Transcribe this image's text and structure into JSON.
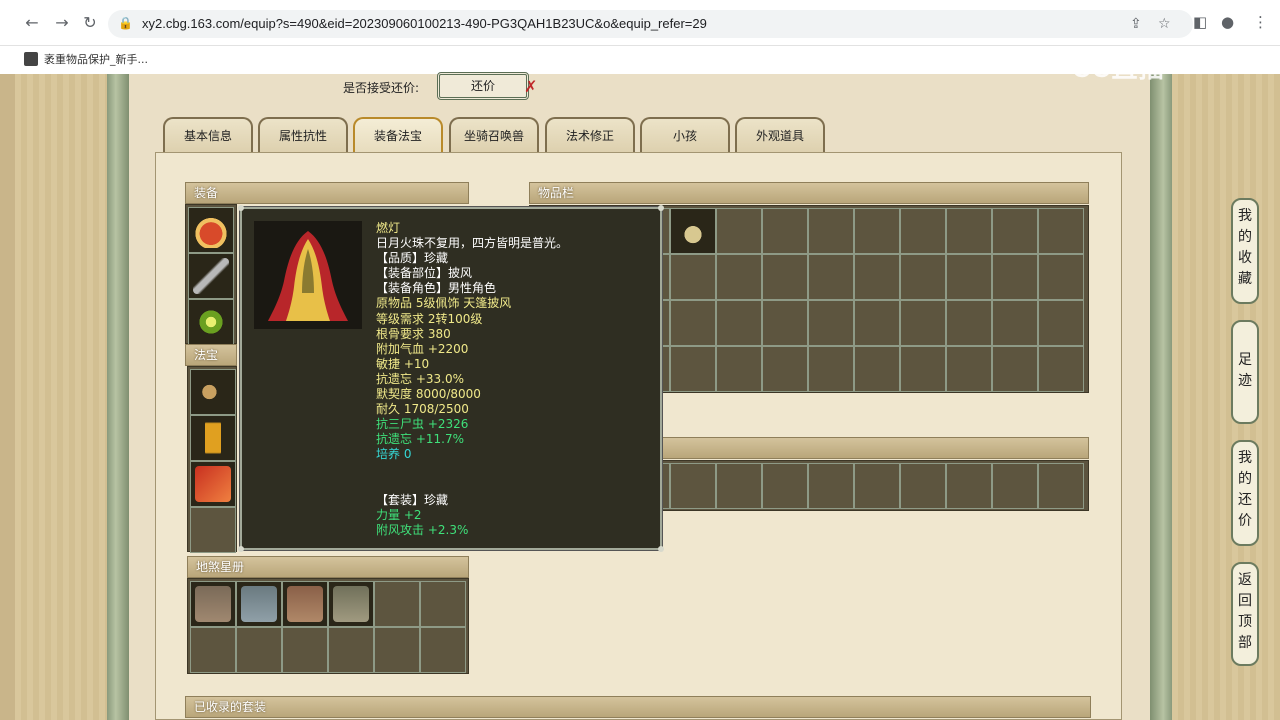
{
  "browser": {
    "url": "xy2.cbg.163.com/equip?s=490&eid=202309060100213-490-PG3QAH1B23UC&o&equip_refer=29",
    "bookmark": "袤重物品保护_新手..."
  },
  "watermark": "CC直播",
  "counter_offer": {
    "label": "是否接受还价:",
    "button": "还价",
    "mark": "✗"
  },
  "tabs": [
    "基本信息",
    "属性抗性",
    "装备法宝",
    "坐骑召唤兽",
    "法术修正",
    "小孩",
    "外观道具"
  ],
  "sections": {
    "equipment": "装备",
    "fabao": "法宝",
    "inventory": "物品栏",
    "disha": "地煞星册",
    "suits": "已收录的套装"
  },
  "side_buttons": [
    [
      "我",
      "的",
      "收",
      "藏"
    ],
    [
      "足",
      "迹"
    ],
    [
      "我",
      "的",
      "还",
      "价"
    ],
    [
      "返",
      "回",
      "顶",
      "部"
    ]
  ],
  "tooltip": {
    "lines": [
      {
        "text": "燃灯",
        "color": "y"
      },
      {
        "text": "日月火珠不复用，四方皆明是普光。",
        "color": "w"
      },
      {
        "text": "【品质】珍藏",
        "color": "w"
      },
      {
        "text": "【装备部位】披风",
        "color": "w"
      },
      {
        "text": "【装备角色】男性角色",
        "color": "w"
      },
      {
        "text": "原物品 5级佩饰 天篷披风",
        "color": "y"
      },
      {
        "text": "等级需求 2转100级",
        "color": "y"
      },
      {
        "text": "根骨要求 380",
        "color": "y"
      },
      {
        "text": "附加气血 +2200",
        "color": "y"
      },
      {
        "text": "敏捷 +10",
        "color": "y"
      },
      {
        "text": "抗遗忘 +33.0%",
        "color": "y"
      },
      {
        "text": "默契度 8000/8000",
        "color": "y"
      },
      {
        "text": "耐久 1708/2500",
        "color": "y"
      },
      {
        "text": "抗三尸虫 +2326",
        "color": "g"
      },
      {
        "text": "抗遗忘 +11.7%",
        "color": "g"
      },
      {
        "text": "培养 0",
        "color": "c"
      },
      {
        "text": "",
        "color": "w"
      },
      {
        "text": "",
        "color": "w"
      },
      {
        "text": "【套装】珍藏",
        "color": "w"
      },
      {
        "text": "力量 +2",
        "color": "g"
      },
      {
        "text": "附风攻击 +2.3%",
        "color": "g"
      }
    ]
  }
}
